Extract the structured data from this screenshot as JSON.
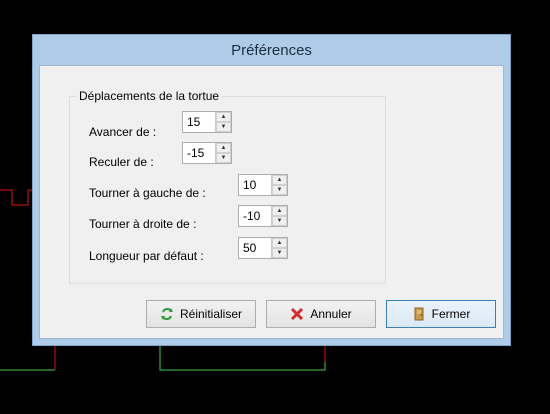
{
  "dialog": {
    "title": "Préférences",
    "group_title": "Déplacements de la tortue",
    "fields": [
      {
        "label": "Avancer de :",
        "value": "15"
      },
      {
        "label": "Reculer de :",
        "value": "-15"
      },
      {
        "label": "Tourner à gauche de :",
        "value": "10"
      },
      {
        "label": "Tourner à droite de :",
        "value": "-10"
      },
      {
        "label": "Longueur par défaut :",
        "value": "50"
      }
    ],
    "buttons": {
      "reset_label": "Réinitialiser",
      "cancel_label": "Annuler",
      "close_label": "Fermer"
    }
  },
  "colors": {
    "background": "#000000",
    "turtle_path_red": "#e01010",
    "turtle_path_green": "#3cd050",
    "dialog_frame": "#aecbe8"
  },
  "icons": {
    "reset": "refresh-arrows-icon",
    "cancel": "red-x-icon",
    "close": "door-icon",
    "spin_up": "triangle-up-icon",
    "spin_down": "triangle-down-icon"
  }
}
